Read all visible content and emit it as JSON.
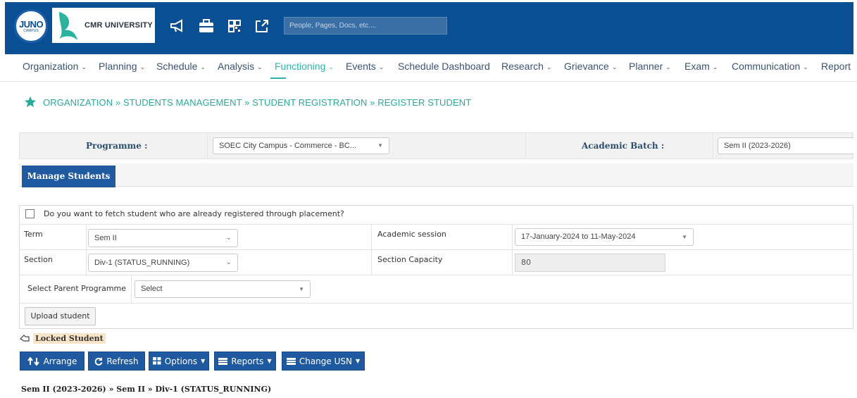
{
  "topbar": {
    "logo_juno": "JUNO",
    "logo_juno_sub": "CAMPUS",
    "logo_cmr": "CMR UNIVERSITY",
    "icons": [
      "megaphone-icon",
      "briefcase-icon",
      "qr-code-icon",
      "external-link-icon"
    ],
    "search_placeholder": "People, Pages, Docs, etc....",
    "brand_color": "#0a4f94"
  },
  "menu": {
    "items": [
      {
        "label": "Organization",
        "caret": "⌄"
      },
      {
        "label": "Planning",
        "caret": "⌄"
      },
      {
        "label": "Schedule",
        "caret": "⌄"
      },
      {
        "label": "Analysis",
        "caret": "⌄"
      },
      {
        "label": "Functioning",
        "caret": "⌄",
        "active": true
      },
      {
        "label": "Events",
        "caret": "⌄"
      },
      {
        "label": "Schedule Dashboard",
        "caret": ""
      },
      {
        "label": "Research",
        "caret": "⌄"
      },
      {
        "label": "Grievance",
        "caret": "⌄"
      },
      {
        "label": "Planner",
        "caret": "⌄"
      },
      {
        "label": "Exam",
        "caret": "⌄"
      },
      {
        "label": "Communication",
        "caret": "⌄"
      },
      {
        "label": "Report",
        "caret": ""
      }
    ],
    "active_color": "#2cb4a8"
  },
  "breadcrumb": {
    "text": "ORGANIZATION » STUDENTS MANAGEMENT » STUDENT REGISTRATION » REGISTER STUDENT"
  },
  "programme_row": {
    "programme_label": "Programme :",
    "programme_value": "SOEC City Campus - Commerce - BC...",
    "batch_label": "Academic Batch :",
    "batch_value": "Sem II (2023-2026)"
  },
  "tabs": {
    "active": "Manage Students"
  },
  "form": {
    "placement_question": "Do you want to fetch student who are already registered through placement?",
    "term_label": "Term",
    "term_value": "Sem II",
    "session_label": "Academic session",
    "session_value": "17-January-2024 to 11-May-2024",
    "section_label": "Section",
    "section_value": "Div-1 (STATUS_RUNNING)",
    "capacity_label": "Section Capacity",
    "capacity_value": "80",
    "parent_label": "Select Parent Programme",
    "parent_value": "Select",
    "upload_button": "Upload student"
  },
  "locked": {
    "label": "Locked Student"
  },
  "actions": {
    "arrange": "Arrange",
    "refresh": "Refresh",
    "options": "Options",
    "reports": "Reports",
    "change_usn": "Change USN"
  },
  "footer": {
    "path": "Sem II (2023-2026) » Sem II » Div-1 (STATUS_RUNNING)"
  }
}
